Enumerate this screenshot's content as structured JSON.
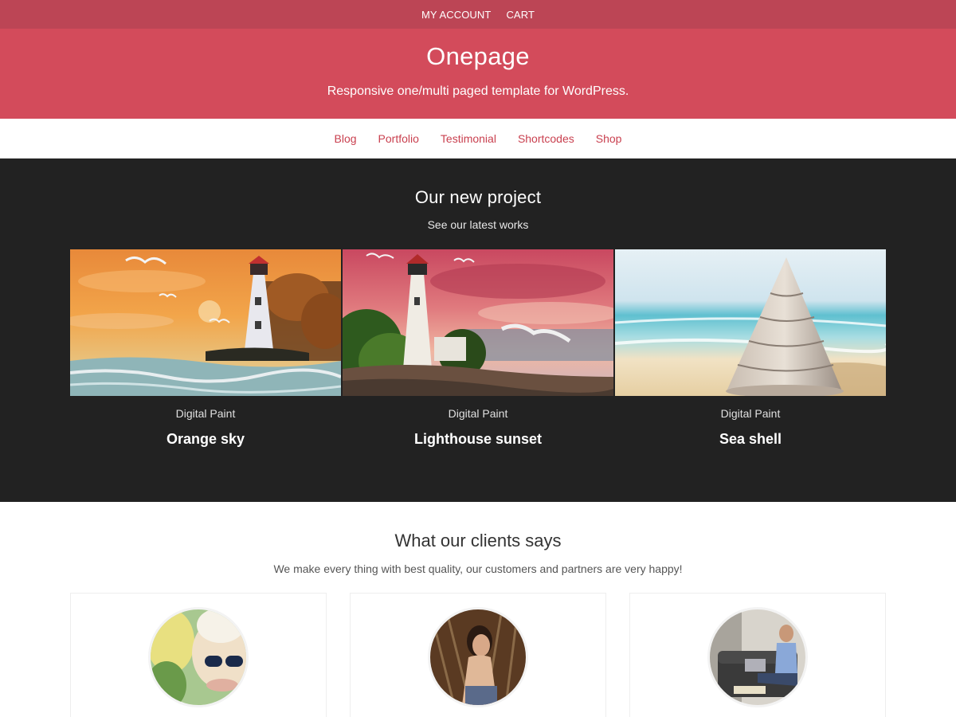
{
  "topbar": {
    "items": [
      "MY ACCOUNT",
      "CART"
    ]
  },
  "header": {
    "title": "Onepage",
    "description": "Responsive one/multi paged template for WordPress."
  },
  "nav": {
    "items": [
      "Blog",
      "Portfolio",
      "Testimonial",
      "Shortcodes",
      "Shop"
    ]
  },
  "projects": {
    "title": "Our new project",
    "subtitle": "See our latest works",
    "items": [
      {
        "category": "Digital Paint",
        "name": "Orange sky"
      },
      {
        "category": "Digital Paint",
        "name": "Lighthouse sunset"
      },
      {
        "category": "Digital Paint",
        "name": "Sea shell"
      }
    ]
  },
  "clients": {
    "title": "What our clients says",
    "subtitle": "We make every thing with best quality, our customers and partners are very happy!"
  },
  "colors": {
    "topbar": "#bc4555",
    "header": "#d34b5b",
    "accent": "#c9404f",
    "dark": "#222222"
  }
}
